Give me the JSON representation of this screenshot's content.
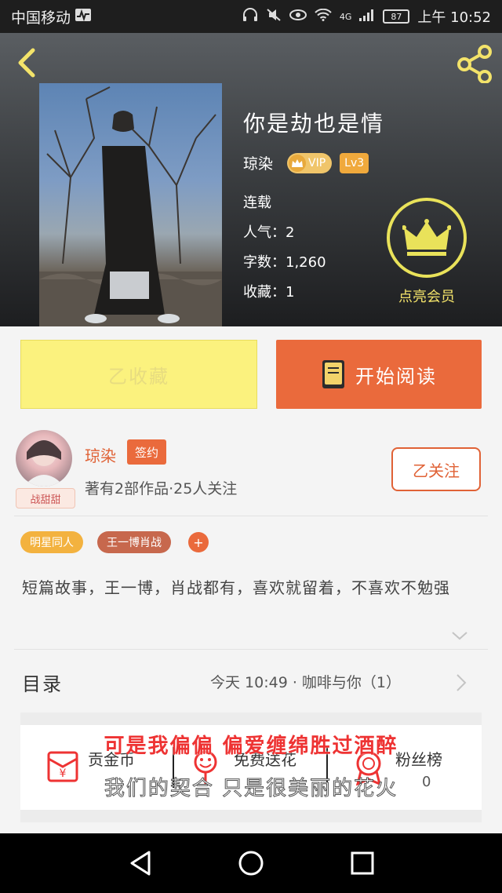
{
  "status_bar": {
    "carrier": "中国移动",
    "network": "4G",
    "battery": "87",
    "time": "上午 10:52"
  },
  "header": {
    "back_icon": "back-arrow-icon",
    "share_icon": "share-icon"
  },
  "book": {
    "title": "你是劫也是情",
    "author": "琼染",
    "vip_label": "VIP",
    "level": "Lv3",
    "status": "连载",
    "popularity": "人气：2",
    "word_count": "字数：1,260",
    "favorites": "收藏：1"
  },
  "vip_promo": {
    "icon": "crown-icon",
    "label": "点亮会员",
    "color": "#e9e25a"
  },
  "actions": {
    "favorite_label": "乙收藏",
    "read_label": "开始阅读",
    "favorite_color": "#fbf27e",
    "read_color": "#ea6a3c"
  },
  "author_card": {
    "name": "琼染",
    "signed_badge": "签约",
    "stats": "著有2部作品·25人关注",
    "follow_label": "乙关注",
    "avatar_tag": "战甜甜"
  },
  "tags": [
    "明星同人",
    "王一博肖战"
  ],
  "tag_add": "+",
  "description": "短篇故事，王一博，肖战都有，喜欢就留着，不喜欢不勉强",
  "toc": {
    "label": "目录",
    "latest_update": "今天 10:49 · 咖啡与你（1）"
  },
  "bottom_actions": [
    {
      "icon": "red-envelope-icon",
      "label": "贡金币"
    },
    {
      "icon": "flower-icon",
      "label": "免费送花"
    },
    {
      "icon": "medal-icon",
      "label": "粉丝榜",
      "value": "0"
    }
  ],
  "lyrics": {
    "line1": "可是我偏偏 偏爱缠绵胜过酒醉",
    "line2": "我们的契合 只是很美丽的花火"
  },
  "nav": {
    "back": "nav-back-icon",
    "home": "nav-home-icon",
    "recent": "nav-recent-icon"
  }
}
